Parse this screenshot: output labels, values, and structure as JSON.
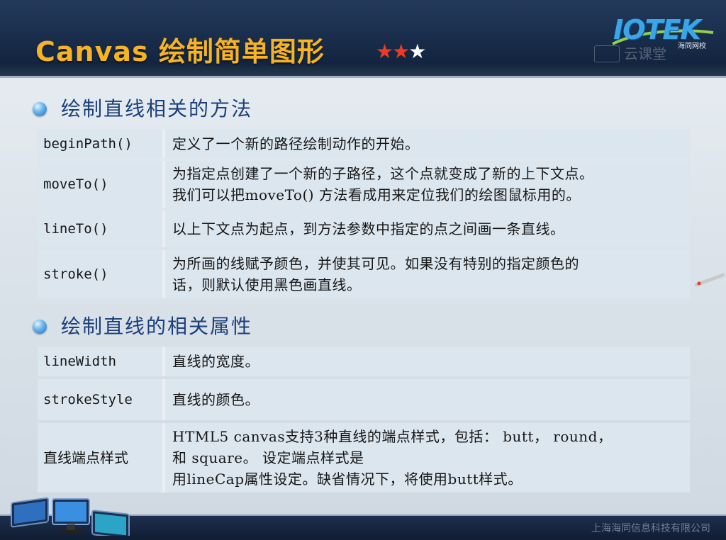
{
  "header": {
    "title": "Canvas 绘制简单图形",
    "stars_filled": "★★",
    "stars_empty": "★",
    "logo": "IOTEK",
    "logo_subtitle": "海同网校",
    "watermark": "云课堂"
  },
  "colors": {
    "title": "#f6b324",
    "heading": "#1c3f7a",
    "cell_bg": "#dbe6ef",
    "star_filled": "#ee3a22",
    "logo": "#3aa6e8"
  },
  "sections": [
    {
      "heading": "绘制直线相关的方法",
      "rows": [
        {
          "key": "beginPath()",
          "lines": [
            "定义了一个新的路径绘制动作的开始。"
          ]
        },
        {
          "key": "moveTo()",
          "lines": [
            "为指定点创建了一个新的子路径，这个点就变成了新的上下文点。",
            "我们可以把moveTo() 方法看成用来定位我们的绘图鼠标用的。"
          ]
        },
        {
          "key": "lineTo()",
          "lines": [
            "以上下文点为起点，到方法参数中指定的点之间画一条直线。"
          ]
        },
        {
          "key": "stroke()",
          "lines": [
            "为所画的线赋予颜色，并使其可见。如果没有特别的指定颜色的",
            "话，则默认使用黑色画直线。"
          ]
        }
      ]
    },
    {
      "heading": "绘制直线的相关属性",
      "rows": [
        {
          "key": "lineWidth",
          "lines": [
            "直线的宽度。"
          ]
        },
        {
          "key": "strokeStyle",
          "lines": [
            "直线的颜色。"
          ]
        },
        {
          "key": "直线端点样式",
          "lines": [
            "HTML5 canvas支持3种直线的端点样式，包括： butt， round，",
            "和 square。 设定端点样式是",
            "用lineCap属性设定。缺省情况下，将使用butt样式。"
          ]
        }
      ]
    }
  ],
  "footer": {
    "company": "上海海同信息科技有限公司"
  }
}
